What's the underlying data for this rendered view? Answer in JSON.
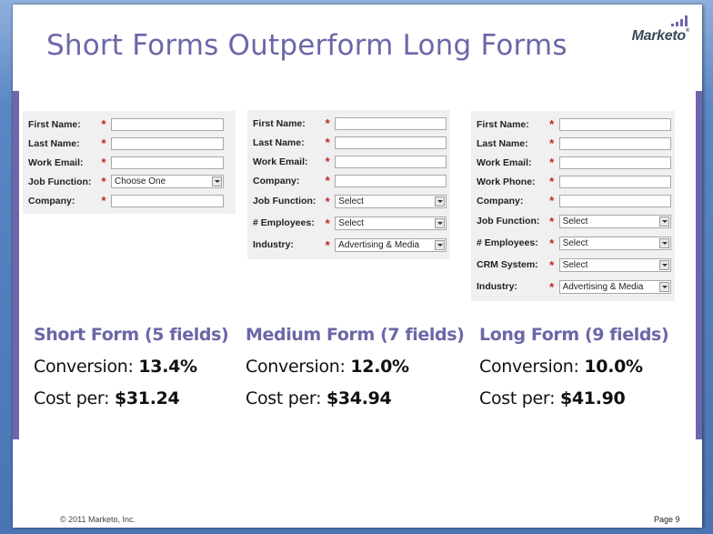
{
  "slide": {
    "title": "Short Forms Outperform Long Forms",
    "logo_text": "Marketo",
    "footer_copyright": "© 2011 Marketo, Inc.",
    "page_label": "Page 9"
  },
  "forms": [
    {
      "name": "short",
      "fields": [
        {
          "label": "First Name:",
          "type": "text",
          "value": ""
        },
        {
          "label": "Last Name:",
          "type": "text",
          "value": ""
        },
        {
          "label": "Work Email:",
          "type": "text",
          "value": ""
        },
        {
          "label": "Job Function:",
          "type": "select",
          "value": "Choose One"
        },
        {
          "label": "Company:",
          "type": "text",
          "value": ""
        }
      ]
    },
    {
      "name": "medium",
      "fields": [
        {
          "label": "First Name:",
          "type": "text",
          "value": ""
        },
        {
          "label": "Last Name:",
          "type": "text",
          "value": ""
        },
        {
          "label": "Work Email:",
          "type": "text",
          "value": ""
        },
        {
          "label": "Company:",
          "type": "text",
          "value": ""
        },
        {
          "label": "Job Function:",
          "type": "select",
          "value": "Select"
        },
        {
          "label": "# Employees:",
          "type": "select",
          "value": "Select"
        },
        {
          "label": "Industry:",
          "type": "select",
          "value": "Advertising & Media"
        }
      ]
    },
    {
      "name": "long",
      "fields": [
        {
          "label": "First Name:",
          "type": "text",
          "value": ""
        },
        {
          "label": "Last Name:",
          "type": "text",
          "value": ""
        },
        {
          "label": "Work Email:",
          "type": "text",
          "value": ""
        },
        {
          "label": "Work Phone:",
          "type": "text",
          "value": ""
        },
        {
          "label": "Company:",
          "type": "text",
          "value": ""
        },
        {
          "label": "Job Function:",
          "type": "select",
          "value": "Select"
        },
        {
          "label": "# Employees:",
          "type": "select",
          "value": "Select"
        },
        {
          "label": "CRM System:",
          "type": "select",
          "value": "Select"
        },
        {
          "label": "Industry:",
          "type": "select",
          "value": "Advertising & Media"
        }
      ]
    }
  ],
  "required_marker": "*",
  "stats": [
    {
      "heading": "Short Form (5 fields)",
      "conversion_label": "Conversion: ",
      "conversion": "13.4%",
      "cost_label": "Cost per: ",
      "cost": "$31.24"
    },
    {
      "heading": "Medium Form (7 fields)",
      "conversion_label": "Conversion: ",
      "conversion": "12.0%",
      "cost_label": "Cost per: ",
      "cost": "$34.94"
    },
    {
      "heading": "Long Form (9 fields)",
      "conversion_label": "Conversion: ",
      "conversion": "10.0%",
      "cost_label": "Cost per: ",
      "cost": "$41.90"
    }
  ]
}
